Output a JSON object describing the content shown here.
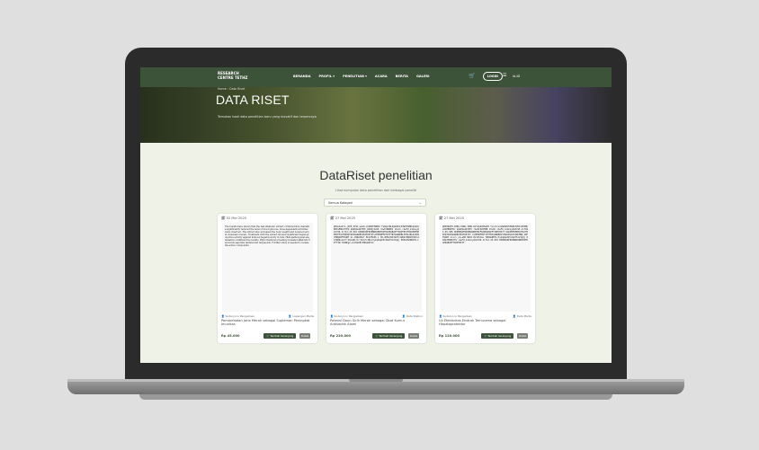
{
  "nav": {
    "brand": "RESEARCH CENTRE TETHZ",
    "menu": [
      "BERANDA",
      "PROFIL ▾",
      "PENELITIAN ▾",
      "ACARA",
      "BERITA",
      "GALERI"
    ],
    "cart_icon": "cart-icon",
    "login_label": "LOGIN",
    "lang_icon": "menu-icon",
    "lang_label": "id-ID"
  },
  "hero": {
    "breadcrumb": "Home  ›  Data Riset",
    "title": "DATA RISET",
    "subtitle": "Temukan hasil data penelitian baru yang inovatif dan terpercaya"
  },
  "section": {
    "title": "DataRiset penelitian",
    "subtitle": "Lihat kumpulan data penelitian dari berbagai peneliti",
    "category_selected": "Semua Kategori"
  },
  "cards": [
    {
      "date": "02 Mei 2025",
      "thumb_text": "The results have shown that the leaf ethanolic extract of Momordica charantia significantly reduced the level of blood glucose. Dose-dependent activities were observed. The extract also increased the body weight and lowered serum cholesterol levels. Treatment with the extract showed significant hepatoprotective activity against induced hepatotoxicity in rats. Histopathological examination confirmed the results. Phytochemical screening revealed alkaloids flavonoids saponins tannins and terpenoids. Further study is needed to isolate the active compounds.",
      "author": "Sudaryo in Pangaduan",
      "category": "Lapangan Medis",
      "title": "Pemanfaatan Jahe Merah sebagai Suplemen Peningkat Imunitas",
      "price": "Rp 45.000",
      "cart_label": "Tambah Keranjang",
      "detail_label": "Detail"
    },
    {
      "date": "27 Mei 2025",
      "thumb_text": "@Pmx4eZrS-{CDE_OI91-wGx8-atUMATPRNXV FuRqUrRL6pWdEoCPJW7KhBRhqSAkSN6tGEWUcPfEQ kpWQ2a4Q7dMr_WdbQjXwV8 rkwHrWRNXI 19+lh ckwFU_GimnLyQ4d=99-1i712.d5.8C8 DKPNEARFNVPNNIDNNTRIFDAPRABAPFTIWPTRSTTRAKPNFDEEBCEFACTBKOQTADXAUNABCOBJMJKTVTLVHHHWFMXT1HTTB3VAWR8BLSTNAJRLRJXINCMNQARFTRUWT Gi-99RA3RLT BCA7MLB6 1 3B-dHHL3N3=WUT=1WQ2rRRRJBlWC14L5QR8+4vCf;IQLq01rCr;BcA7c1B1c3y2qbmp6P=ZaU75zVIqQj 80ZG35KN8JFm-LIFTIUrrK4Nkgu-sL45sbBcVMKaUb5lk",
      "author": "Sudaryo in Pangaduan",
      "category": "Data Statiun",
      "title": "Potensi Daun Sirih Merah sebagai Obat Kumur Antiseptik Alami",
      "price": "Rp 220.000",
      "cart_label": "Tambah Keranjang",
      "detail_label": "Detail"
    },
    {
      "date": "27 Mei 2025",
      "thumb_text": "@H65NnHH-1B8U-XSRD-IPRK-R2lDsbCNSm1M YocnSrvdLBA6HV5HIRkTVD3zdEZBhaXkPBNXYRc kpWQ2a4Q7dMr rkwHrQ2QH9B 19+0h ckwFU_GimnLyQ4d=99-1i71N6.D5.S88 DKPNEARFNVPNNIDNNTRIFDAPRABAPFTIWPTRSTT RAKPNFDEEBCEFACTBKOQTADXAUNABCOBJMJKTVT LVHHHWFMXT1HTTB3VAWR8BLSTNAJRLRJXINCMNQ ARFTRUWT nixcl_oC+a88 N9O2 B2J45JGu YN8AbNBY1c3y2qbmp6P=ZaU75zVIqQj 80ZG35KN8JFm ckwFU_GimnLyQ4d=99-1i712.d5.8C8 DKPNEARFNVPNNIDNNTRIFDAPRABAPFTIWPTRSTT",
      "author": "Sudaryo in Pangaduan",
      "category": "Data Medis",
      "title": "Uji Efektivitas Ekstrak Temurama sebagai Hepatoprotektor",
      "price": "Rp 120.000",
      "cart_label": "Tambah Keranjang",
      "detail_label": "Detail"
    }
  ]
}
